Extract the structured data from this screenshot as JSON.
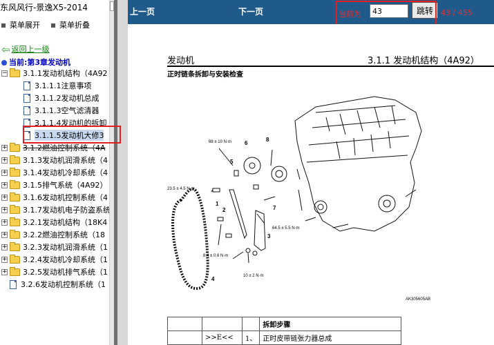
{
  "app": {
    "title": "东风风行-景逸X5-2014"
  },
  "menu": {
    "expand_label": "菜单展开",
    "collapse_label": "菜单折叠"
  },
  "nav": {
    "back_label": "返回上一级",
    "current_label": "当前:第3章发动机"
  },
  "tree": [
    {
      "label": "3.1.1发动机结构（4A92",
      "type": "folder",
      "toggle": "−"
    },
    {
      "label": "3.1.1.1注意事项",
      "type": "doc"
    },
    {
      "label": "3.1.1.2发动机总成",
      "type": "doc"
    },
    {
      "label": "3.1.1.3空气滤清器",
      "type": "doc"
    },
    {
      "label": "3.1.1.4发动机的拆卸",
      "type": "doc"
    },
    {
      "label": "3.1.1.5发动机大修3",
      "type": "doc",
      "selected": true
    },
    {
      "label": "3.1.2燃油控制系统（4A",
      "type": "folder",
      "toggle": "+"
    },
    {
      "label": "3.1.3发动机润滑系统（4",
      "type": "folder",
      "toggle": "+"
    },
    {
      "label": "3.1.4发动机冷却系统（4",
      "type": "folder",
      "toggle": "+"
    },
    {
      "label": "3.1.5排气系统（4A92）",
      "type": "folder",
      "toggle": "+"
    },
    {
      "label": "3.1.6发动机控制系统（4",
      "type": "folder",
      "toggle": "+"
    },
    {
      "label": "3.1.7发动机电子防盗系统",
      "type": "folder",
      "toggle": "+"
    },
    {
      "label": "3.2.1发动机结构（18K4",
      "type": "folder",
      "toggle": "+"
    },
    {
      "label": "3.2.2燃油控制系统（18",
      "type": "folder",
      "toggle": "+"
    },
    {
      "label": "3.2.3发动机润滑系统（1",
      "type": "folder",
      "toggle": "+"
    },
    {
      "label": "3.2.4发动机冷却系统（1",
      "type": "folder",
      "toggle": "+"
    },
    {
      "label": "3.2.5发动机排气系统（1",
      "type": "folder",
      "toggle": "+"
    },
    {
      "label": "3.2.6发动机控制系统（1",
      "type": "doc"
    }
  ],
  "toolbar": {
    "prev_label": "上一页",
    "next_label": "下一页",
    "current_label": "当前为",
    "page_value": "43",
    "go_label": "跳转",
    "page_count": "43 / 455"
  },
  "document": {
    "section_left": "发动机",
    "section_right": "3.1.1 发动机结构（4A92）",
    "subtitle": "正时链条拆卸与安装检查",
    "diagram_labels": {
      "torque_top": "88 ± 10 N·m",
      "torque_left": "23.5 ± 4.5 N·m",
      "torque_right": "64.5 ± 5.5 N·m",
      "torque_mid": "8.4 ± 0.6 N·m",
      "torque_bottom": "10 ± 2 N·m",
      "code": "AK305605AB",
      "n1": "1",
      "n2": "2",
      "n3": "3",
      "n4": "4",
      "n5": "5",
      "n6": "6",
      "n7": "7",
      "n8": "8"
    },
    "steps_header": "拆卸步骤",
    "steps": [
      {
        "col1": "",
        "col2": ">>E<<",
        "num": "1、",
        "text": "正时皮带链张力器总成"
      }
    ]
  },
  "colors": {
    "toolbar": "#1f5a8b",
    "highlight": "#e02020",
    "accent_text": "#e03030"
  }
}
